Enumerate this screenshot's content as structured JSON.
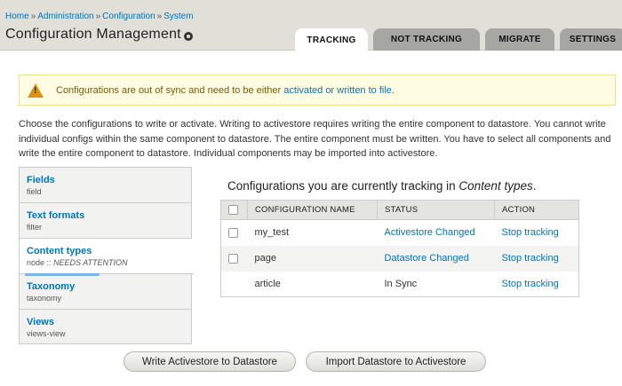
{
  "breadcrumb": [
    "Home",
    "Administration",
    "Configuration",
    "System"
  ],
  "breadcrumb_sep": "»",
  "page_title": "Configuration Management",
  "tabs": [
    {
      "label": "TRACKING",
      "active": true
    },
    {
      "label": "NOT TRACKING",
      "active": false
    },
    {
      "label": "MIGRATE",
      "active": false
    },
    {
      "label": "SETTINGS",
      "active": false
    }
  ],
  "warning": {
    "text": "Configurations are out of sync and need to be either",
    "link": "activated or written to file",
    "end": "."
  },
  "intro": "Choose the configurations to write or activate. Writing to activestore requires writing the entire component to datastore. You cannot write individual configs within the same component to datastore. The entire component must be written. You have to select all components and write the entire component to datastore. Individual components may be imported into activestore.",
  "vtabs": [
    {
      "title": "Fields",
      "desc": "field"
    },
    {
      "title": "Text formats",
      "desc": "filter"
    },
    {
      "title": "Content types",
      "desc_prefix": "node :: ",
      "desc_status": "NEEDS ATTENTION"
    },
    {
      "title": "Taxonomy",
      "desc": "taxonomy"
    },
    {
      "title": "Views",
      "desc": "views-view"
    }
  ],
  "content": {
    "heading": "Configurations you are currently tracking in",
    "heading_em": "Content types",
    "heading_end": "."
  },
  "table": {
    "headers": [
      "CONFIGURATION NAME",
      "STATUS",
      "ACTION"
    ],
    "rows": [
      {
        "name": "my_test",
        "status": "Activestore Changed",
        "action": "Stop tracking"
      },
      {
        "name": "page",
        "status": "Datastore Changed",
        "action": "Stop tracking"
      },
      {
        "name": "article",
        "status": "In Sync",
        "action": "Stop tracking"
      }
    ]
  },
  "buttons": {
    "write": "Write Activestore to Datastore",
    "import": "Import Datastore to Activestore"
  }
}
